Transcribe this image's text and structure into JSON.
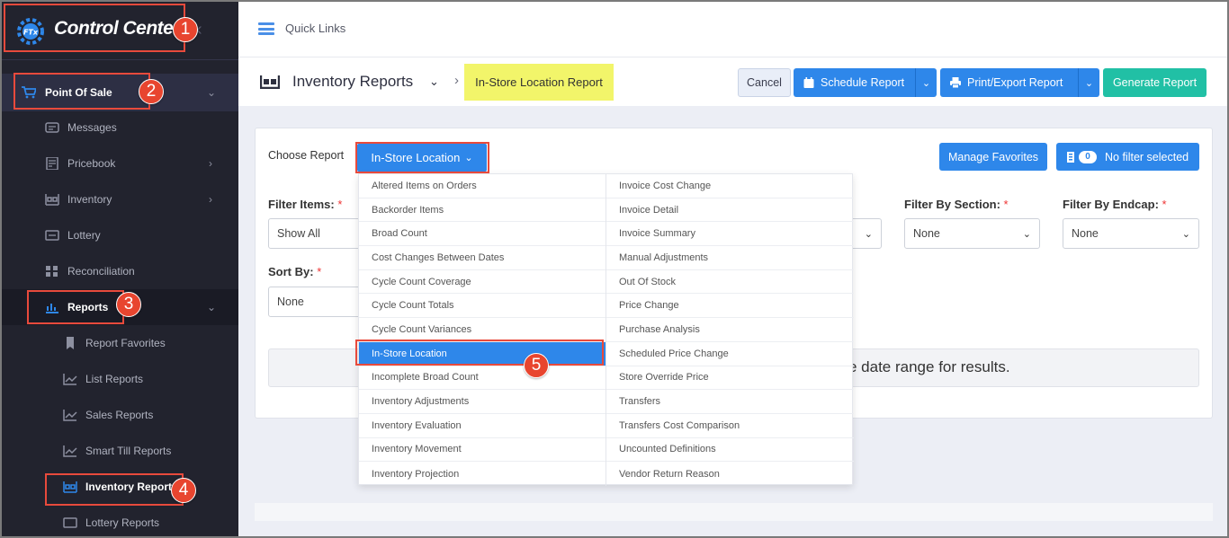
{
  "brand": {
    "logo_text": "FTx",
    "name": "Control Center"
  },
  "sidebar": {
    "section": {
      "label": "Point Of Sale"
    },
    "items": [
      {
        "label": "Messages",
        "icon": "messages-icon"
      },
      {
        "label": "Pricebook",
        "icon": "pricebook-icon"
      },
      {
        "label": "Inventory",
        "icon": "inventory-icon"
      },
      {
        "label": "Lottery",
        "icon": "lottery-icon"
      },
      {
        "label": "Reconciliation",
        "icon": "reconciliation-icon"
      },
      {
        "label": "Reports",
        "icon": "reports-icon"
      }
    ],
    "report_items": [
      {
        "label": "Report Favorites",
        "icon": "bookmark-icon"
      },
      {
        "label": "List Reports",
        "icon": "chart-line-icon"
      },
      {
        "label": "Sales Reports",
        "icon": "chart-line-icon"
      },
      {
        "label": "Smart Till Reports",
        "icon": "chart-line-icon"
      },
      {
        "label": "Inventory Reports",
        "icon": "inventory-icon"
      },
      {
        "label": "Lottery Reports",
        "icon": "lottery-icon"
      }
    ]
  },
  "topbar": {
    "quick_links": "Quick Links"
  },
  "header": {
    "title": "Inventory Reports",
    "breadcrumb_current": "In-Store Location Report",
    "cancel": "Cancel",
    "schedule": "Schedule Report",
    "print": "Print/Export Report",
    "generate": "Generate Report"
  },
  "content": {
    "choose_label": "Choose Report",
    "choose_value": "In-Store Location",
    "manage_favorites": "Manage Favorites",
    "filter_count": "0",
    "no_filter": "No filter selected",
    "filter_items_label": "Filter Items:",
    "filter_items_value": "Show All",
    "sort_by_label": "Sort By:",
    "sort_by_value": "None",
    "filter_section_label": "Filter By Section:",
    "filter_section_value": "None",
    "filter_endcap_label": "Filter By Endcap:",
    "filter_endcap_value": "None",
    "required_mark": "*",
    "message": "e date range for results."
  },
  "dropdown": {
    "left": [
      "Altered Items on Orders",
      "Backorder Items",
      "Broad Count",
      "Cost Changes Between Dates",
      "Cycle Count Coverage",
      "Cycle Count Totals",
      "Cycle Count Variances",
      "In-Store Location",
      "Incomplete Broad Count",
      "Inventory Adjustments",
      "Inventory Evaluation",
      "Inventory Movement",
      "Inventory Projection"
    ],
    "right": [
      "Invoice Cost Change",
      "Invoice Detail",
      "Invoice Summary",
      "Manual Adjustments",
      "Out Of Stock",
      "Price Change",
      "Purchase Analysis",
      "Scheduled Price Change",
      "Store Override Price",
      "Transfers",
      "Transfers Cost Comparison",
      "Uncounted Definitions",
      "Vendor Return Reason"
    ],
    "selected": "In-Store Location"
  },
  "annotations": [
    "1",
    "2",
    "3",
    "4",
    "5"
  ],
  "colors": {
    "accent": "#2e87ea",
    "generate": "#21c0a5",
    "highlight": "#f2f56a",
    "annotation": "#e84a3c",
    "sidebar": "#22232e"
  }
}
